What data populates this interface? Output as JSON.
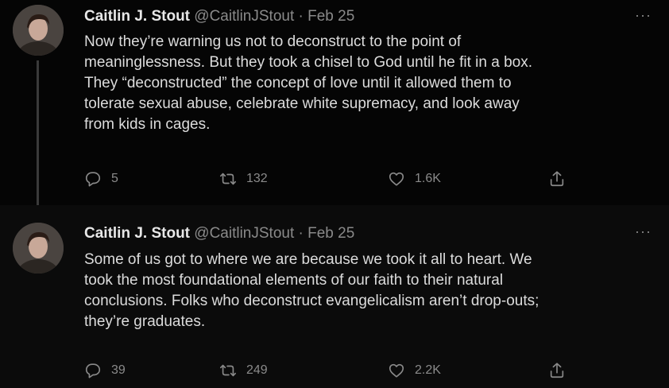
{
  "tweets": [
    {
      "author_name": "Caitlin J. Stout",
      "handle": "@CaitlinJStout",
      "separator": "·",
      "date": "Feb 25",
      "more_icon": "···",
      "text": "Now they’re warning us not to deconstruct to the point of\nmeaninglessness. But they took a chisel to God until he fit in a box.\nThey “deconstructed” the concept of love until it allowed them to\ntolerate sexual abuse, celebrate white supremacy, and look away\nfrom kids in cages.",
      "replies": "5",
      "retweets": "132",
      "likes": "1.6K"
    },
    {
      "author_name": "Caitlin J. Stout",
      "handle": "@CaitlinJStout",
      "separator": "·",
      "date": "Feb 25",
      "more_icon": "···",
      "text": "Some of us got to where we are because we took it all to heart. We\ntook the most foundational elements of our faith to their natural\nconclusions. Folks who deconstruct evangelicalism aren’t drop-outs;\nthey’re graduates.",
      "replies": "39",
      "retweets": "249",
      "likes": "2.2K"
    }
  ],
  "icons": {
    "reply": "reply-icon",
    "retweet": "retweet-icon",
    "like": "heart-icon",
    "share": "share-icon"
  }
}
